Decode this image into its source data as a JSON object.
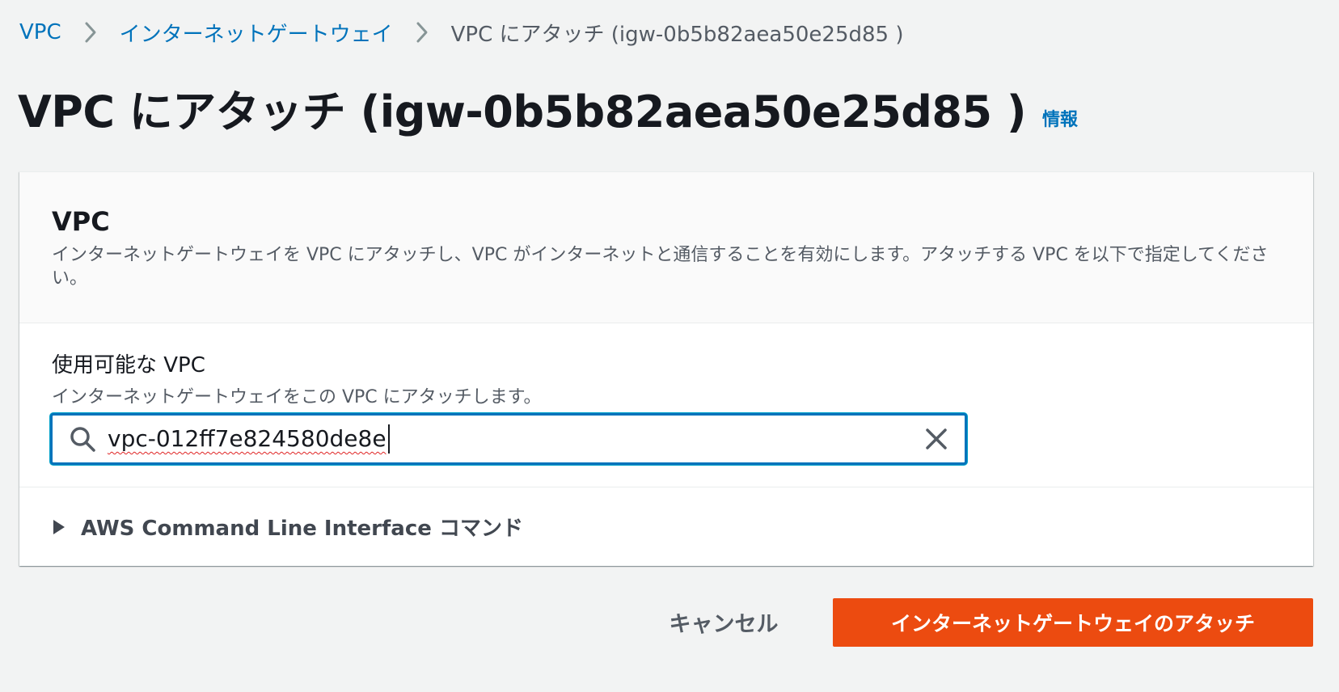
{
  "breadcrumb": {
    "items": [
      {
        "label": "VPC"
      },
      {
        "label": "インターネットゲートウェイ"
      },
      {
        "label": "VPC にアタッチ (igw-0b5b82aea50e25d85 )"
      }
    ]
  },
  "header": {
    "title": "VPC にアタッチ (igw-0b5b82aea50e25d85 )",
    "info_link": "情報"
  },
  "container": {
    "title": "VPC",
    "description": "インターネットゲートウェイを VPC にアタッチし、VPC がインターネットと通信することを有効にします。アタッチする VPC を以下で指定してください。"
  },
  "vpc_field": {
    "label": "使用可能な VPC",
    "description": "インターネットゲートウェイをこの VPC にアタッチします。",
    "value": "vpc-012ff7e824580de8e"
  },
  "cli_section": {
    "label": "AWS Command Line Interface コマンド"
  },
  "actions": {
    "cancel_label": "キャンセル",
    "submit_label": "インターネットゲートウェイのアタッチ"
  },
  "colors": {
    "link": "#0073bb",
    "primary": "#ec4b10",
    "focus_border": "#0073bb",
    "background": "#f2f3f3"
  },
  "icons": {
    "breadcrumb_separator": "chevron-right-icon",
    "search": "search-icon",
    "clear": "close-icon",
    "expand": "caret-right-icon"
  }
}
